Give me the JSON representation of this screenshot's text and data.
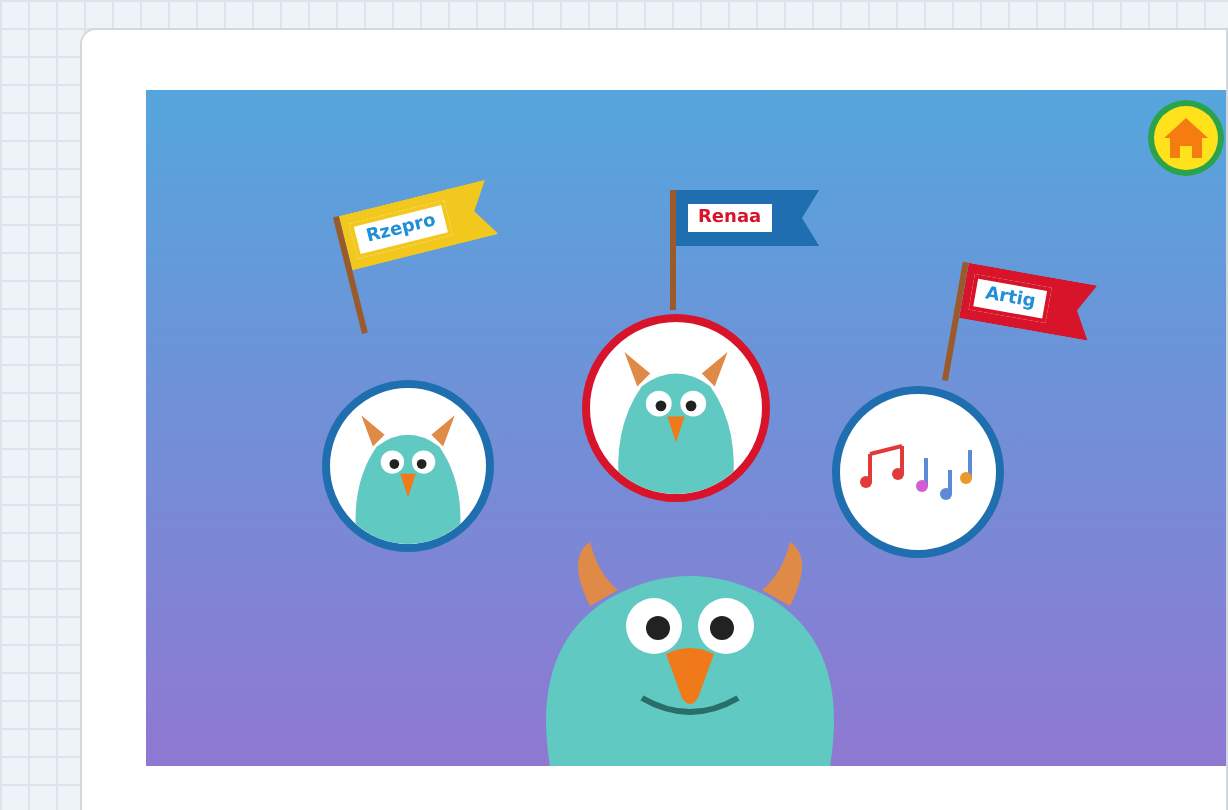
{
  "activities": [
    {
      "label": "Rzepro",
      "color": "#f2c81e",
      "selected": false,
      "kind": "monster"
    },
    {
      "label": "Renaa",
      "color": "#1f6fb0",
      "selected": true,
      "kind": "monster"
    },
    {
      "label": "Artig",
      "color": "#d8142a",
      "selected": false,
      "kind": "notes"
    }
  ]
}
